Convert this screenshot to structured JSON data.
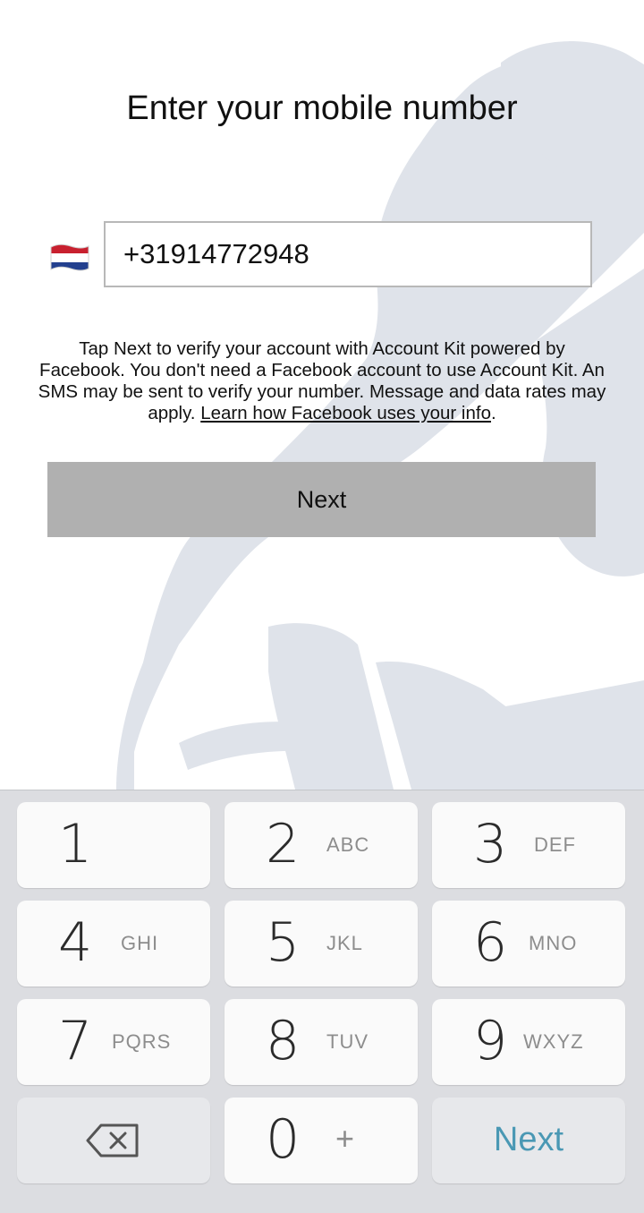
{
  "title": "Enter your mobile number",
  "country_flag": "netherlands-flag-icon",
  "phone_number": "+31914772948",
  "disclaimer": {
    "text": "Tap Next to verify your account with Account Kit powered by Facebook. You don't need a Facebook account to use Account Kit. An SMS may be sent to verify your number. Message and data rates may apply. ",
    "link": "Learn how Facebook uses your info",
    "end": "."
  },
  "next_button": "Next",
  "keypad": {
    "k1": {
      "digit": "1",
      "letters": ""
    },
    "k2": {
      "digit": "2",
      "letters": "ABC"
    },
    "k3": {
      "digit": "3",
      "letters": "DEF"
    },
    "k4": {
      "digit": "4",
      "letters": "GHI"
    },
    "k5": {
      "digit": "5",
      "letters": "JKL"
    },
    "k6": {
      "digit": "6",
      "letters": "MNO"
    },
    "k7": {
      "digit": "7",
      "letters": "PQRS"
    },
    "k8": {
      "digit": "8",
      "letters": "TUV"
    },
    "k9": {
      "digit": "9",
      "letters": "WXYZ"
    },
    "k0": {
      "digit": "0",
      "letters": "+"
    },
    "backspace": "backspace-icon",
    "next": "Next"
  },
  "colors": {
    "next_button_bg": "#b0b0b0",
    "keyboard_bg": "#dcdde1",
    "keyboard_next": "#4a98b4",
    "background_art": "#dfe3ea"
  }
}
